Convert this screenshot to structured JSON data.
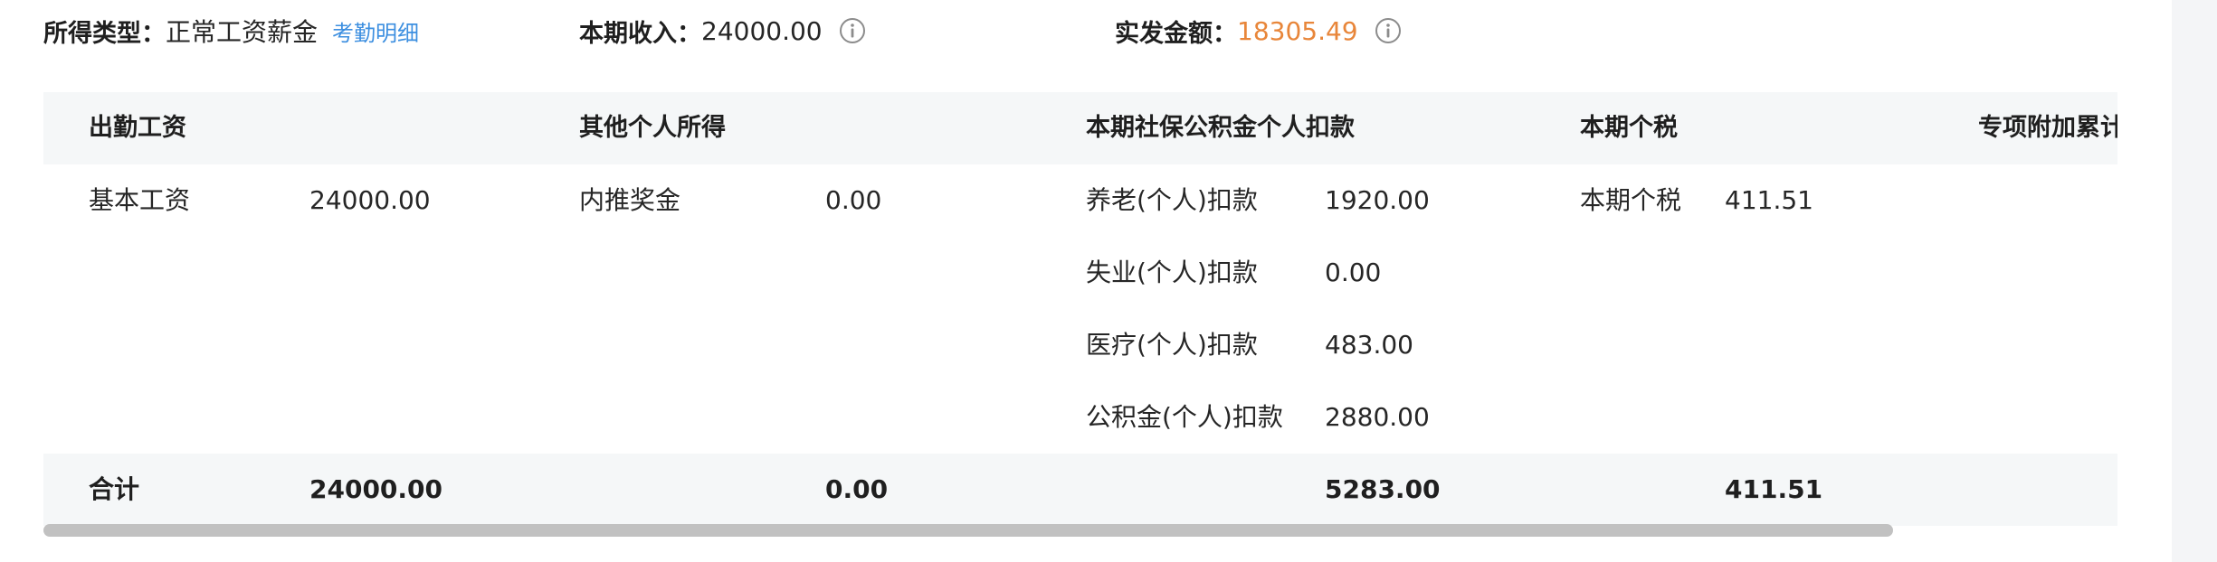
{
  "summary": {
    "income_type_label": "所得类型：",
    "income_type_value": "正常工资薪金",
    "attendance_link": "考勤明细",
    "current_income_label": "本期收入：",
    "current_income_value": "24000.00",
    "net_pay_label": "实发金额：",
    "net_pay_value": "18305.49",
    "net_pay_color": "#e8863a",
    "link_color": "#3d8fe0",
    "info_icon": "info-circle-icon"
  },
  "table": {
    "headers": {
      "attendance_wage": "出勤工资",
      "other_income": "其他个人所得",
      "social_insurance": "本期社保公积金个人扣款",
      "current_tax": "本期个税",
      "special_deduction": "专项附加累计"
    },
    "rows": {
      "basic_wage_label": "基本工资",
      "basic_wage_value": "24000.00",
      "bonus_label": "内推奖金",
      "bonus_value": "0.00",
      "pension_label": "养老(个人)扣款",
      "pension_value": "1920.00",
      "unemployment_label": "失业(个人)扣款",
      "unemployment_value": "0.00",
      "medical_label": "医疗(个人)扣款",
      "medical_value": "483.00",
      "housing_fund_label": "公积金(个人)扣款",
      "housing_fund_value": "2880.00",
      "tax_label": "本期个税",
      "tax_value": "411.51"
    },
    "total": {
      "label": "合计",
      "attendance_total": "24000.00",
      "other_total": "0.00",
      "social_total": "5283.00",
      "tax_total": "411.51"
    }
  }
}
